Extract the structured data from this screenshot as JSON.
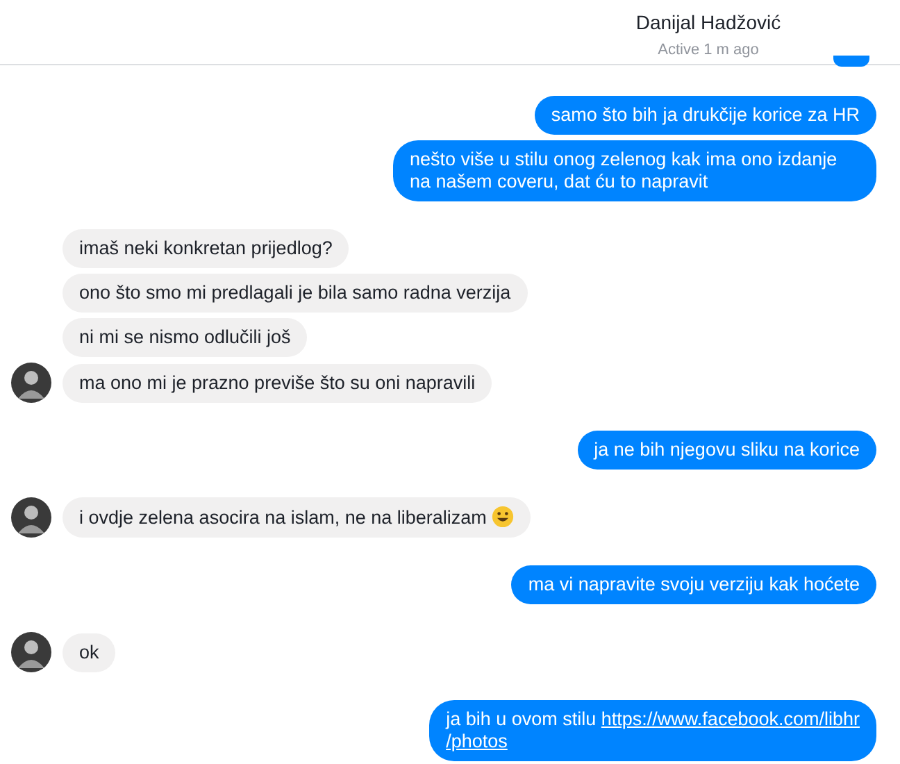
{
  "header": {
    "name": "Danijal Hadžović",
    "status": "Active 1 m ago"
  },
  "groups": [
    {
      "from_me": true,
      "messages": [
        {
          "text": "samo što bih ja drukčije korice za HR"
        },
        {
          "text": "nešto više u stilu onog zelenog kak ima ono izdanje na našem coveru, dat ću to napravit"
        }
      ]
    },
    {
      "from_me": false,
      "messages": [
        {
          "text": "imaš neki konkretan prijedlog?"
        },
        {
          "text": "ono što smo mi predlagali je bila samo radna verzija"
        },
        {
          "text": "ni mi se nismo odlučili još"
        },
        {
          "text": "ma ono mi je prazno previše što su oni napravili"
        }
      ]
    },
    {
      "from_me": true,
      "messages": [
        {
          "text": "ja ne bih njegovu sliku na korice"
        }
      ]
    },
    {
      "from_me": false,
      "messages": [
        {
          "text": "i ovdje zelena asocira na islam, ne na liberalizam",
          "emoji": true
        }
      ]
    },
    {
      "from_me": true,
      "messages": [
        {
          "text": "ma vi napravite svoju verziju kak hoćete"
        }
      ]
    },
    {
      "from_me": false,
      "messages": [
        {
          "text": "ok"
        }
      ]
    },
    {
      "from_me": true,
      "messages": [
        {
          "text": "ja bih u ovom stilu",
          "link_lines": [
            "https://www.facebook.com/libhr",
            "/photos"
          ]
        }
      ]
    }
  ]
}
